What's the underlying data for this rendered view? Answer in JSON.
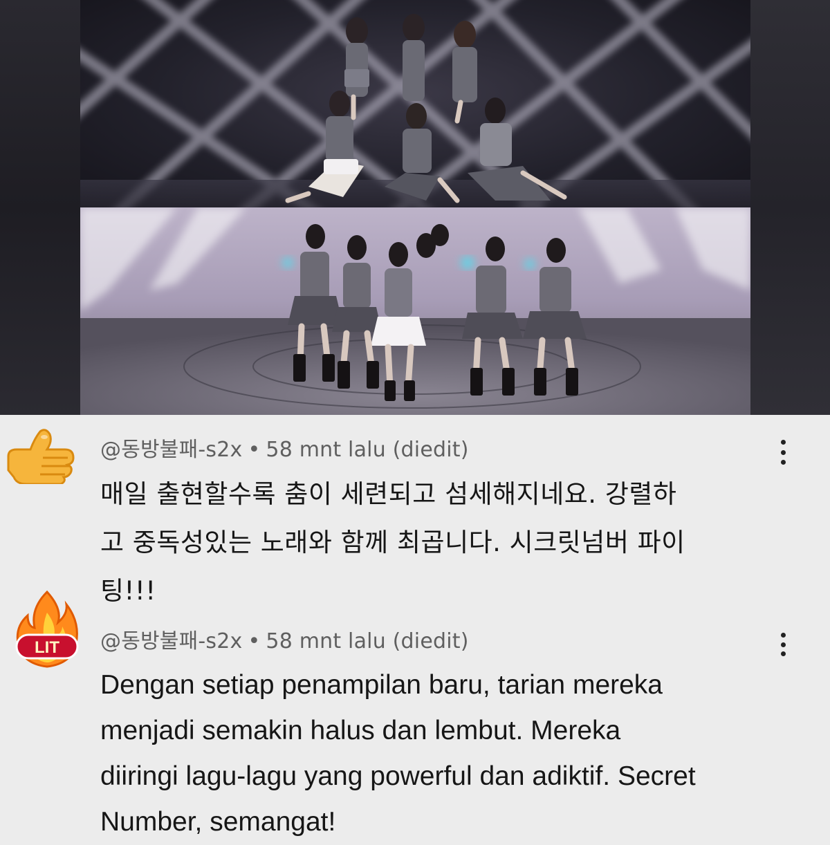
{
  "comments": [
    {
      "reaction_icon": "thumbs-up-icon",
      "author": "@동방불패-s2x",
      "separator": "•",
      "time": "58 mnt lalu (diedit)",
      "text": "매일 출현할수록 춤이 세련되고 섬세해지네요. 강렬하\n고 중독성있는 노래와 함께 최곱니다. 시크릿넘버 파이\n팅!!!"
    },
    {
      "reaction_icon": "lit-fire-icon",
      "reaction_label": "LIT",
      "author": "@동방불패-s2x",
      "separator": "•",
      "time": "58 mnt lalu (diedit)",
      "text": "Dengan setiap penampilan baru, tarian mereka\nmenjadi semakin halus dan lembut. Mereka\ndiiringi lagu-lagu yang powerful dan adiktif. Secret\nNumber, semangat!"
    }
  ],
  "colors": {
    "background": "#ececec",
    "meta_text": "#5f5f5f",
    "body_text": "#161616",
    "thumb": "#f6b53c",
    "fire": "#ff8a1c",
    "lit_badge": "#c8102e"
  }
}
